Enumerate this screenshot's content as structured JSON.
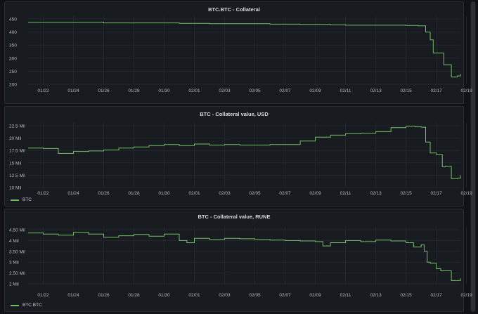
{
  "colors": {
    "series": "#73bf69",
    "grid": "#24272d",
    "tick_text": "#b8b9c0"
  },
  "chart_data": [
    {
      "type": "line",
      "title": "BTC.BTC - Collateral",
      "x_ticks": [
        "01/22",
        "01/24",
        "01/26",
        "01/28",
        "01/30",
        "02/01",
        "02/03",
        "02/05",
        "02/07",
        "02/09",
        "02/11",
        "02/13",
        "02/15",
        "02/17",
        "02/19"
      ],
      "xlim": [
        "01/21",
        "02/19 ~15:00"
      ],
      "y_ticks": [
        "450",
        "400",
        "350",
        "300",
        "250",
        "200"
      ],
      "ylim": [
        200,
        450
      ],
      "grid": true,
      "legend_position": "none",
      "series": [
        {
          "x": [
            0,
            1,
            5,
            10,
            12,
            16,
            18,
            20,
            21,
            25,
            25.8,
            26.3,
            26.6,
            26.8,
            27,
            27.4,
            27.5,
            27.8,
            28,
            28.2,
            28.4,
            28.6
          ],
          "y": [
            437,
            437,
            435,
            433,
            432,
            430,
            429,
            428,
            426,
            425,
            424,
            400,
            370,
            320,
            320,
            320,
            275,
            275,
            228,
            228,
            232,
            240
          ]
        }
      ]
    },
    {
      "type": "line",
      "title": "BTC - Collateral value, USD",
      "x_ticks": [
        "01/22",
        "01/24",
        "01/26",
        "01/28",
        "01/30",
        "02/01",
        "02/03",
        "02/05",
        "02/07",
        "02/09",
        "02/11",
        "02/13",
        "02/15",
        "02/17",
        "02/19"
      ],
      "xlim": [
        "01/21",
        "02/19 ~15:00"
      ],
      "y_ticks": [
        "22.5 Mil",
        "20 Mil",
        "17.5 Mil",
        "15 Mil",
        "12.5 Mil",
        "10 Mil"
      ],
      "ylim": [
        10,
        22.5
      ],
      "unit": "Mil",
      "grid": true,
      "legend_position": "bottom-left",
      "series": [
        {
          "name": "BTC",
          "x": [
            0,
            1,
            2,
            3,
            4,
            5,
            6,
            7,
            8,
            9,
            10,
            11,
            12,
            13,
            14,
            15,
            16,
            17,
            18,
            19,
            20,
            21,
            22,
            23,
            24,
            25,
            25.6,
            26,
            26.3,
            26.6,
            27,
            27.4,
            27.6,
            28,
            28.4,
            28.6
          ],
          "y": [
            18.0,
            17.9,
            16.9,
            17.3,
            17.4,
            17.6,
            18.0,
            18.2,
            18.5,
            18.7,
            18.5,
            18.8,
            18.6,
            18.7,
            18.6,
            18.6,
            18.7,
            18.7,
            19.4,
            20.2,
            20.6,
            20.9,
            21.0,
            21.3,
            22.1,
            22.4,
            22.3,
            22.2,
            19.2,
            17.0,
            16.7,
            14.2,
            14.3,
            11.8,
            11.9,
            12.5
          ]
        }
      ]
    },
    {
      "type": "line",
      "title": "BTC - Collateral value, RUNE",
      "x_ticks": [
        "01/22",
        "01/24",
        "01/26",
        "01/28",
        "01/30",
        "02/01",
        "02/03",
        "02/05",
        "02/07",
        "02/09",
        "02/11",
        "02/13",
        "02/15",
        "02/17",
        "02/19"
      ],
      "xlim": [
        "01/21",
        "02/19 ~15:00"
      ],
      "y_ticks": [
        "4.50 Mil",
        "4 Mil",
        "3.50 Mil",
        "3 Mil",
        "2.50 Mil",
        "2 Mil"
      ],
      "ylim": [
        2.0,
        4.5
      ],
      "unit": "Mil",
      "grid": true,
      "legend_position": "bottom-left",
      "series": [
        {
          "name": "BTC.BTC",
          "x": [
            0,
            1,
            2,
            3,
            4,
            5,
            6,
            7,
            8,
            9,
            10,
            10.5,
            11,
            12,
            13,
            14,
            15,
            16,
            17,
            18,
            19,
            19.5,
            20,
            21,
            22,
            23,
            24,
            25,
            25.5,
            26,
            26.2,
            26.4,
            26.6,
            27,
            27.3,
            27.6,
            28,
            28.3,
            28.6
          ],
          "y": [
            4.35,
            4.3,
            4.25,
            4.38,
            4.3,
            4.15,
            4.22,
            4.28,
            4.2,
            4.3,
            4.0,
            3.9,
            4.1,
            4.05,
            4.1,
            4.08,
            4.05,
            4.02,
            4.0,
            3.98,
            3.95,
            3.75,
            3.9,
            4.0,
            3.95,
            4.02,
            3.98,
            3.9,
            3.7,
            3.8,
            3.5,
            3.0,
            2.95,
            2.7,
            2.6,
            2.6,
            2.15,
            2.15,
            2.25
          ]
        }
      ]
    }
  ]
}
